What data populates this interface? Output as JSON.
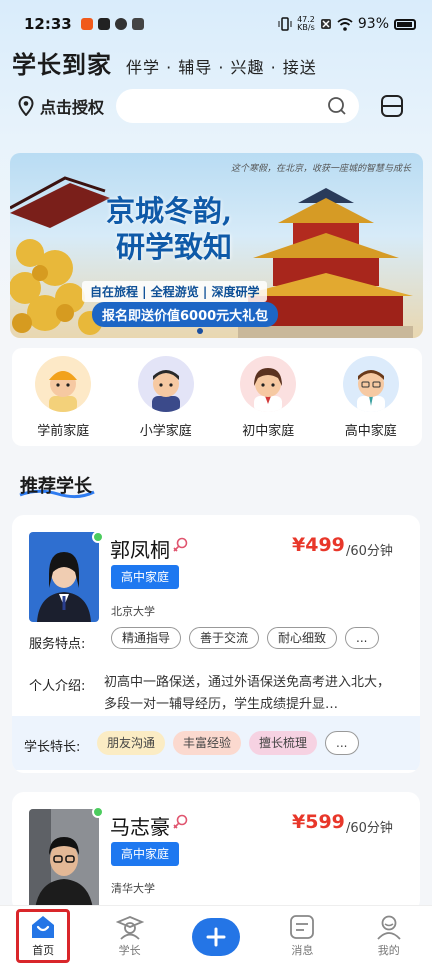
{
  "status_bar": {
    "time": "12:33",
    "net_speed_value": "47.2",
    "net_speed_unit": "KB/s",
    "battery": "93%"
  },
  "header": {
    "brand": "学长到家",
    "tagline": "伴学 · 辅导 · 兴趣 · 接送"
  },
  "location": {
    "label": "点击授权"
  },
  "search": {
    "value": "",
    "placeholder": ""
  },
  "banner": {
    "sky_text": "这个寒假，在北京，收获一座城的智慧与成长",
    "title_line1": "京城冬韵,",
    "title_line2": "研学致知",
    "features": "自在旅程 | 全程游览 | 深度研学",
    "offer": "报名即送价值6000元大礼包"
  },
  "categories": [
    {
      "label": "学前家庭",
      "icon": "preschool-avatar-icon"
    },
    {
      "label": "小学家庭",
      "icon": "primary-avatar-icon"
    },
    {
      "label": "初中家庭",
      "icon": "middle-school-avatar-icon"
    },
    {
      "label": "高中家庭",
      "icon": "high-school-avatar-icon"
    }
  ],
  "section": {
    "title": "推荐学长"
  },
  "tutors": [
    {
      "name": "郭凤桐",
      "price": "¥499",
      "unit": "/60分钟",
      "level": "高中家庭",
      "school": "北京大学",
      "features_label": "服务特点:",
      "features": [
        "精通指导",
        "善于交流",
        "耐心细致",
        "..."
      ],
      "intro_label": "个人介绍:",
      "intro": "初高中一路保送，通过外语保送免高考进入北大，多段一对一辅导经历，学生成绩提升显…",
      "specialty_label": "学长特长:",
      "specialties": [
        {
          "label": "朋友沟通",
          "color": "#fbecc4"
        },
        {
          "label": "丰富经验",
          "color": "#fbd9cf"
        },
        {
          "label": "擅长梳理",
          "color": "#f6d2e2"
        },
        {
          "label": "...",
          "color": "#ffffff"
        }
      ]
    },
    {
      "name": "马志豪",
      "price": "¥599",
      "unit": "/60分钟",
      "level": "高中家庭",
      "school": "清华大学"
    }
  ],
  "nav": [
    {
      "label": "首页",
      "icon": "home-icon",
      "active": true
    },
    {
      "label": "学长",
      "icon": "tutor-icon",
      "active": false
    },
    {
      "label": "",
      "icon": "plus-icon",
      "active": false
    },
    {
      "label": "消息",
      "icon": "message-icon",
      "active": false
    },
    {
      "label": "我的",
      "icon": "profile-icon",
      "active": false
    }
  ],
  "colors": {
    "accent": "#1e78f0",
    "price": "#e8372a",
    "highlight_frame": "#d9262a"
  }
}
